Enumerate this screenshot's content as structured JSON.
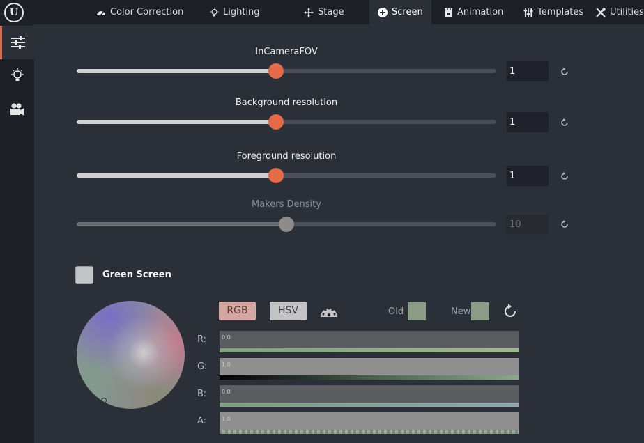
{
  "tabs": [
    {
      "label": "Color Correction",
      "icon": "gauge-icon"
    },
    {
      "label": "Lighting",
      "icon": "lightbulb-icon"
    },
    {
      "label": "Stage",
      "icon": "move-icon"
    },
    {
      "label": "Screen",
      "icon": "plus-circle-icon",
      "active": true
    },
    {
      "label": "Animation",
      "icon": "clapper-icon"
    },
    {
      "label": "Templates",
      "icon": "sliders-icon"
    },
    {
      "label": "Utilities",
      "icon": "tools-icon"
    }
  ],
  "sidebar": [
    {
      "icon": "sliders-icon",
      "active": true
    },
    {
      "icon": "lightbulb-icon"
    },
    {
      "icon": "camera-icon"
    }
  ],
  "sliders": [
    {
      "label": "InCameraFOV",
      "value": "1",
      "fraction": 0.475,
      "enabled": true
    },
    {
      "label": "Background resolution",
      "value": "1",
      "fraction": 0.475,
      "enabled": true
    },
    {
      "label": "Foreground resolution",
      "value": "1",
      "fraction": 0.475,
      "enabled": true
    },
    {
      "label": "Makers Density",
      "value": "10",
      "fraction": 0.5,
      "enabled": false
    }
  ],
  "green_screen": {
    "label": "Green Screen",
    "checked": false,
    "mode_rgb": "RGB",
    "mode_hsv": "HSV",
    "old_label": "Old",
    "new_label": "New",
    "swatch_color": "#8a9c86",
    "channels": [
      {
        "label": "R:",
        "value": "0.0"
      },
      {
        "label": "G:",
        "value": "1.0"
      },
      {
        "label": "B:",
        "value": "0.0"
      },
      {
        "label": "A:",
        "value": "1.0"
      }
    ]
  },
  "colors": {
    "accent": "#e46a48",
    "background": "#2b2f38",
    "topbar": "#1d2027"
  }
}
